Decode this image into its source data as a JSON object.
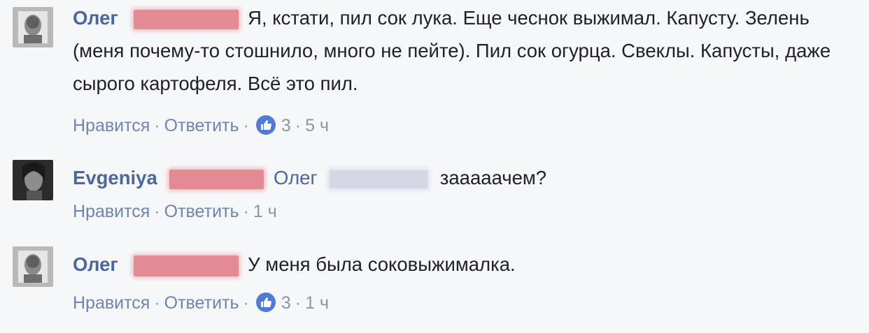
{
  "comments": [
    {
      "author": "Олег",
      "text": "Я, кстати, пил сок лука. Еще чеснок выжимал. Капусту. Зелень (меня почему-то стошнило, много не пейте). Пил сок огурца. Свеклы. Капусты, даже сырого картофеля. Всё это пил.",
      "like_label": "Нравится",
      "reply_label": "Ответить",
      "reactions": "3",
      "time": "5 ч",
      "reaction_icon": "thumbs-up-icon"
    },
    {
      "author": "Evgeniya",
      "mention": "Олег",
      "text": "зааааачем?",
      "like_label": "Нравится",
      "reply_label": "Ответить",
      "time": "1 ч"
    },
    {
      "author": "Олег",
      "text": "У меня была соковыжималка.",
      "like_label": "Нравится",
      "reply_label": "Ответить",
      "reactions": "3",
      "time": "1 ч",
      "reaction_icon": "thumbs-up-icon"
    }
  ],
  "colors": {
    "author": "#4b67a1",
    "text": "#1d2129",
    "meta": "#90949c",
    "like_badge": "#4f7ad7",
    "redaction": "#e27f88"
  }
}
